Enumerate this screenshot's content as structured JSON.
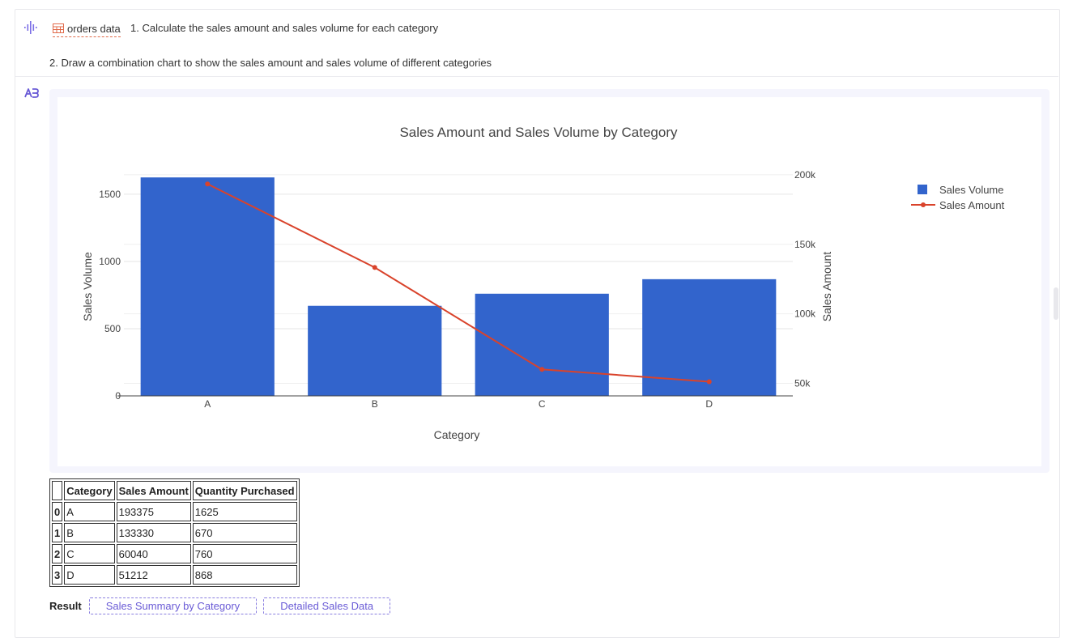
{
  "conversation": {
    "question_icon": "voice-wave-icon",
    "data_chip": {
      "icon": "table-icon",
      "label": "orders data"
    },
    "line1": "1. Calculate the sales amount and sales volume for each category",
    "line2": "2. Draw a combination chart to show the sales amount and sales volume of different categories",
    "answer_icon": "assistant-logo-icon"
  },
  "colors": {
    "bar": "#3264cc",
    "line": "#d9432b",
    "accent": "#6a5bd6"
  },
  "chart_data": {
    "type": "bar",
    "title": "Sales Amount and Sales Volume by Category",
    "xlabel": "Category",
    "categories": [
      "A",
      "B",
      "C",
      "D"
    ],
    "series": [
      {
        "name": "Sales Volume",
        "type": "bar",
        "axis": "left",
        "values": [
          1625,
          670,
          760,
          868
        ]
      },
      {
        "name": "Sales Amount",
        "type": "line",
        "axis": "right",
        "values": [
          193375,
          133330,
          60040,
          51212
        ]
      }
    ],
    "y_left": {
      "label": "Sales Volume",
      "ticks": [
        0,
        500,
        1000,
        1500
      ],
      "tick_labels": [
        "0",
        "500",
        "1000",
        "1500"
      ],
      "range": [
        0,
        1650
      ]
    },
    "y_right": {
      "label": "Sales Amount",
      "ticks": [
        50000,
        100000,
        150000,
        200000
      ],
      "tick_labels": [
        "50k",
        "100k",
        "150k",
        "200k"
      ],
      "range": [
        41000,
        200500
      ]
    },
    "legend_position": "top-right",
    "grid": true
  },
  "table": {
    "columns": [
      "",
      "Category",
      "Sales Amount",
      "Quantity Purchased"
    ],
    "rows": [
      [
        "0",
        "A",
        "193375",
        "1625"
      ],
      [
        "1",
        "B",
        "133330",
        "670"
      ],
      [
        "2",
        "C",
        "60040",
        "760"
      ],
      [
        "3",
        "D",
        "51212",
        "868"
      ]
    ]
  },
  "result": {
    "label": "Result",
    "buttons": [
      "Sales Summary by Category",
      "Detailed Sales Data"
    ]
  }
}
